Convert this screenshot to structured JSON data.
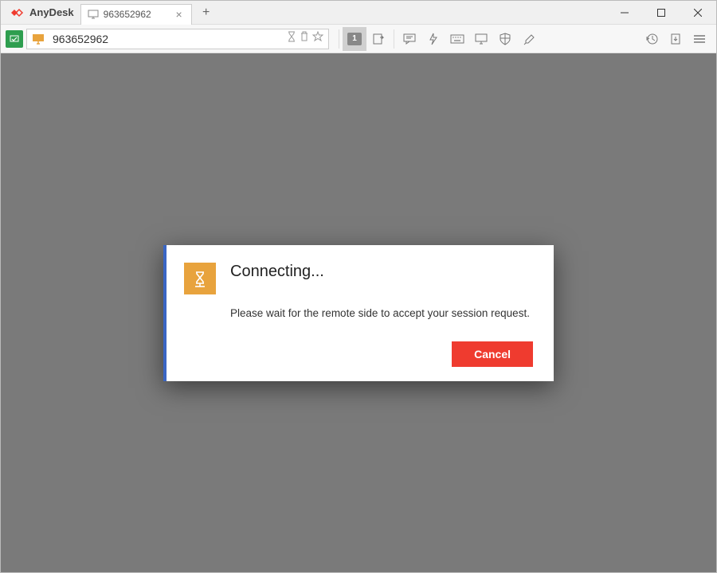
{
  "app": {
    "name": "AnyDesk"
  },
  "tab": {
    "label": "963652962"
  },
  "address": {
    "value": "963652962"
  },
  "toolbar": {
    "monitor_badge": "1"
  },
  "dialog": {
    "title": "Connecting...",
    "message": "Please wait for the remote side to accept your session request.",
    "cancel": "Cancel"
  }
}
